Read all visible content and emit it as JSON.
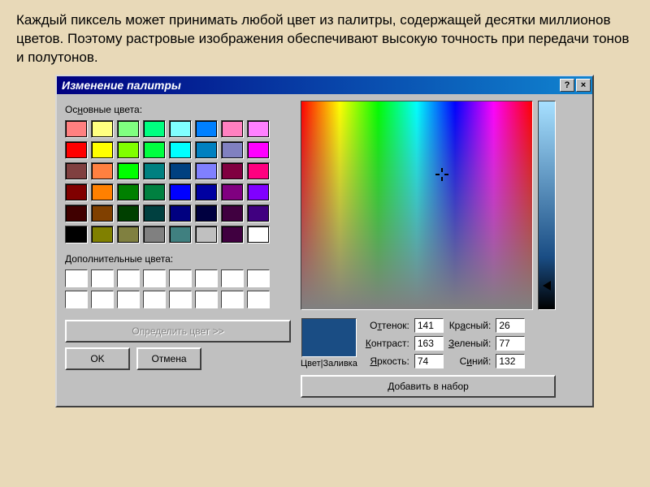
{
  "page_text": "Каждый пиксель может принимать любой цвет из палитры, содержащей десятки миллионов цветов. Поэтому растровые изображения обеспечивают высокую точность при передачи тонов и полутонов.",
  "dialog": {
    "title": "Изменение палитры",
    "help_btn": "?",
    "close_btn": "×",
    "basic_label": "Основные цвета:",
    "custom_label": "Дополнительные цвета:",
    "define_btn": "Определить цвет >>",
    "ok_btn": "OK",
    "cancel_btn": "Отмена",
    "add_btn": "Добавить в набор",
    "preview_label": "Цвет|Заливка",
    "fields": {
      "hue_label": "Оттенок:",
      "hue": "141",
      "sat_label": "Контраст:",
      "sat": "163",
      "lum_label": "Яркость:",
      "lum": "74",
      "red_label": "Красный:",
      "red": "26",
      "green_label": "Зеленый:",
      "green": "77",
      "blue_label": "Синий:",
      "blue": "132"
    },
    "preview_color": "#1a4d84"
  },
  "basic_colors": [
    "#ff8080",
    "#ffff80",
    "#80ff80",
    "#00ff80",
    "#80ffff",
    "#0080ff",
    "#ff80c0",
    "#ff80ff",
    "#ff0000",
    "#ffff00",
    "#80ff00",
    "#00ff40",
    "#00ffff",
    "#0080c0",
    "#8080c0",
    "#ff00ff",
    "#804040",
    "#ff8040",
    "#00ff00",
    "#008080",
    "#004080",
    "#8080ff",
    "#800040",
    "#ff0080",
    "#800000",
    "#ff8000",
    "#008000",
    "#008040",
    "#0000ff",
    "#0000a0",
    "#800080",
    "#8000ff",
    "#400000",
    "#804000",
    "#004000",
    "#004040",
    "#000080",
    "#000040",
    "#400040",
    "#400080",
    "#000000",
    "#808000",
    "#808040",
    "#808080",
    "#408080",
    "#c0c0c0",
    "#400040",
    "#ffffff"
  ]
}
